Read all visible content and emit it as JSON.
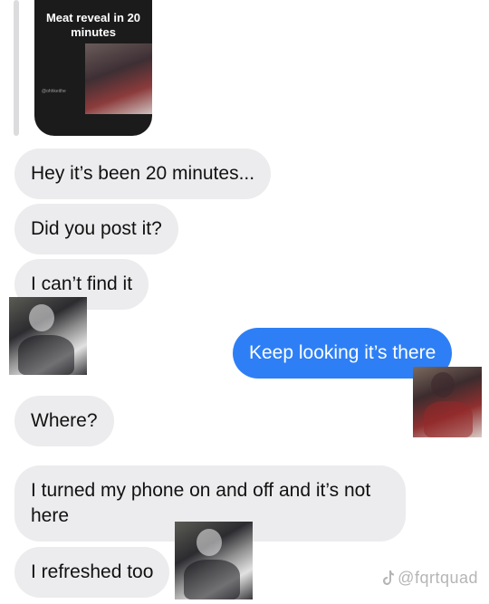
{
  "story_reply": {
    "title": "Meat reveal in 20 minutes",
    "handle": "@ohhkeithe"
  },
  "messages": [
    {
      "text": "Hey it’s been 20 minutes..."
    },
    {
      "text": "Did you post it?"
    },
    {
      "text": "I can’t find it"
    },
    {
      "text": "Keep looking it’s there"
    },
    {
      "text": "Where?"
    },
    {
      "text": "I turned my phone on and off and it’s not here"
    },
    {
      "text": "I refreshed too"
    }
  ],
  "stickers": [
    {
      "icon": "armored-character-sticker"
    },
    {
      "icon": "red-jacket-character-sticker"
    },
    {
      "icon": "armored-character-sticker"
    }
  ],
  "watermark": {
    "icon": "tiktok-icon",
    "text": "@fqrtquad"
  },
  "colors": {
    "received_bubble": "#ececee",
    "sent_bubble": "#2e7ff5",
    "story_card": "#1b1b1b"
  }
}
